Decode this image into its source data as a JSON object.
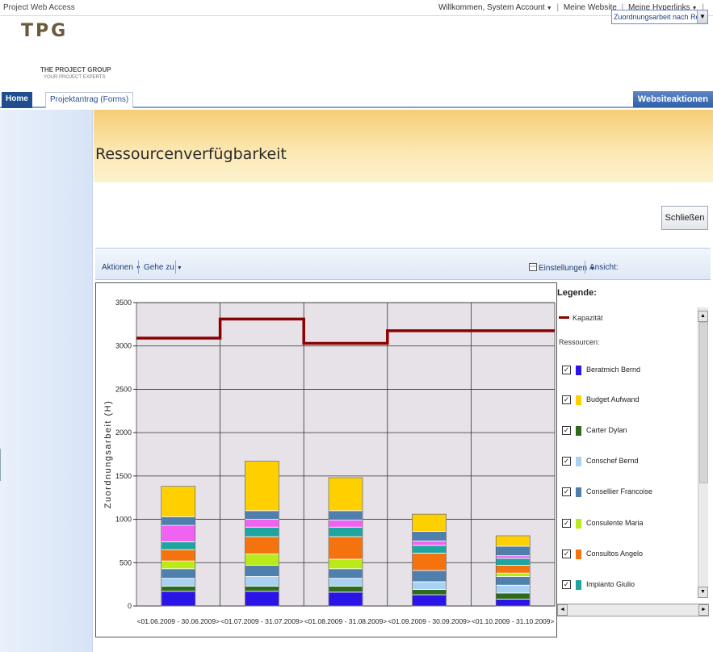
{
  "topbar": {
    "site_title": "Project Web Access",
    "welcome": "Willkommen, System Account",
    "my_site": "Meine Website",
    "my_links": "Meine Hyperlinks"
  },
  "logo": {
    "brand": "TPG",
    "line1": "THE PROJECT GROUP",
    "line2": "YOUR PROJECT EXPERTS"
  },
  "nav": {
    "tabs": [
      "Home",
      "Projektantrag (Forms)"
    ],
    "site_actions": "Websiteaktionen"
  },
  "page": {
    "title": "Ressourcenverfügbarkeit",
    "close_label": "Schließen"
  },
  "toolbar": {
    "actions": "Aktionen",
    "goto": "Gehe zu",
    "settings": "Einstellungen",
    "view_label": "Ansicht:",
    "view_value": "Zuordnungsarbeit nach Ressource"
  },
  "legend": {
    "title": "Legende:",
    "capacity": "Kapazität",
    "resources_label": "Ressourcen:",
    "items": [
      {
        "name": "Beratmich Bernd",
        "color": "#2a14e6"
      },
      {
        "name": "Budget Aufwand",
        "color": "#ffd000"
      },
      {
        "name": "Carter Dylan",
        "color": "#2e6b1f"
      },
      {
        "name": "Conschef Bernd",
        "color": "#a9d2f2"
      },
      {
        "name": "Consellier Francoise",
        "color": "#4f7fad"
      },
      {
        "name": "Consulente Maria",
        "color": "#b9ea1a"
      },
      {
        "name": "Consultos Angelo",
        "color": "#f4730f"
      },
      {
        "name": "Impianto Giulio",
        "color": "#1fa5a0"
      }
    ]
  },
  "chart_data": {
    "type": "bar",
    "ylabel": "Zuordnungsarbeit (H)",
    "ylim": [
      0,
      3500
    ],
    "yticks": [
      0,
      500,
      1000,
      1500,
      2000,
      2500,
      3000,
      3500
    ],
    "grid": true,
    "categories": [
      "<01.06.2009 - 30.06.2009>",
      "<01.07.2009 - 31.07.2009>",
      "<01.08.2009 - 31.08.2009>",
      "<01.09.2009 - 30.09.2009>",
      "<01.10.2009 - 31.10.2009>"
    ],
    "capacity": {
      "name": "Kapazität",
      "color": "#8b0000",
      "values": [
        3090,
        3310,
        3030,
        3175,
        3175
      ]
    },
    "stacks": [
      [
        [
          "#2a14e6",
          170
        ],
        [
          "#2e6b1f",
          60
        ],
        [
          "#a9d2f2",
          90
        ],
        [
          "#4f7fad",
          110
        ],
        [
          "#b9ea1a",
          90
        ],
        [
          "#f4730f",
          130
        ],
        [
          "#1fa5a0",
          90
        ],
        [
          "#f062f0",
          190
        ],
        [
          "#4f7fad",
          100
        ],
        [
          "#ffd000",
          350
        ]
      ],
      [
        [
          "#2a14e6",
          170
        ],
        [
          "#2e6b1f",
          60
        ],
        [
          "#a9d2f2",
          110
        ],
        [
          "#4f7fad",
          130
        ],
        [
          "#b9ea1a",
          130
        ],
        [
          "#f4730f",
          200
        ],
        [
          "#1fa5a0",
          110
        ],
        [
          "#f062f0",
          90
        ],
        [
          "#4f7fad",
          100
        ],
        [
          "#ffd000",
          570
        ]
      ],
      [
        [
          "#2a14e6",
          160
        ],
        [
          "#2e6b1f",
          70
        ],
        [
          "#a9d2f2",
          90
        ],
        [
          "#4f7fad",
          110
        ],
        [
          "#b9ea1a",
          110
        ],
        [
          "#f4730f",
          260
        ],
        [
          "#1fa5a0",
          110
        ],
        [
          "#f062f0",
          80
        ],
        [
          "#4f7fad",
          110
        ],
        [
          "#ffd000",
          380
        ]
      ],
      [
        [
          "#2a14e6",
          130
        ],
        [
          "#2e6b1f",
          60
        ],
        [
          "#a9d2f2",
          90
        ],
        [
          "#4f7fad",
          130
        ],
        [
          "#f4730f",
          200
        ],
        [
          "#1fa5a0",
          90
        ],
        [
          "#f062f0",
          50
        ],
        [
          "#4f7fad",
          110
        ],
        [
          "#ffd000",
          200
        ]
      ],
      [
        [
          "#2a14e6",
          80
        ],
        [
          "#2e6b1f",
          70
        ],
        [
          "#a9d2f2",
          90
        ],
        [
          "#4f7fad",
          100
        ],
        [
          "#b9ea1a",
          40
        ],
        [
          "#f4730f",
          90
        ],
        [
          "#1fa5a0",
          80
        ],
        [
          "#f062f0",
          30
        ],
        [
          "#4f7fad",
          110
        ],
        [
          "#ffd000",
          120
        ]
      ]
    ]
  }
}
